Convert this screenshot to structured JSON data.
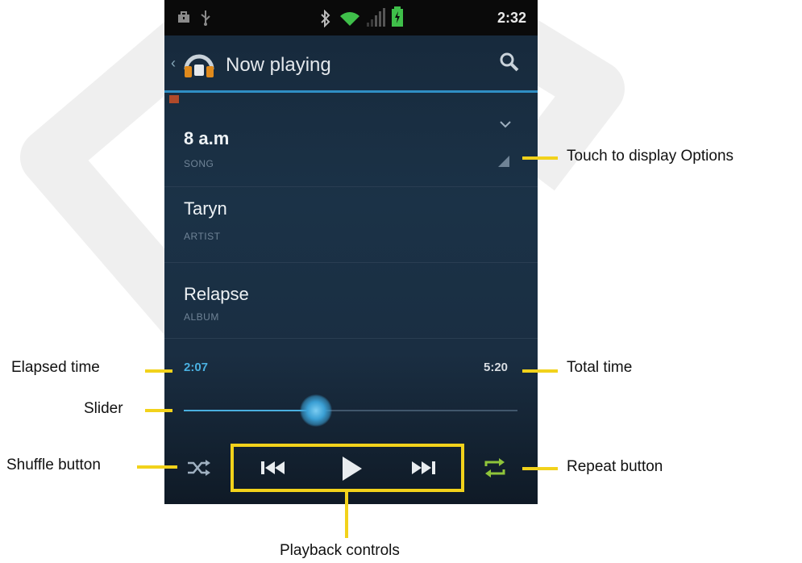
{
  "status_bar": {
    "clock": "2:32"
  },
  "action_bar": {
    "title": "Now playing"
  },
  "track": {
    "song": {
      "value": "8 a.m",
      "label": "SONG"
    },
    "artist": {
      "value": "Taryn",
      "label": "ARTIST"
    },
    "album": {
      "value": "Relapse",
      "label": "ALBUM"
    }
  },
  "playback": {
    "elapsed": "2:07",
    "total": "5:20",
    "progress": 0.397
  },
  "callouts": {
    "options": "Touch to display Options",
    "elapsed": "Elapsed time",
    "total": "Total time",
    "slider": "Slider",
    "shuffle": "Shuffle button",
    "repeat": "Repeat button",
    "playback": "Playback controls"
  },
  "colors": {
    "accent_blue": "#4ab0e0",
    "repeat_green": "#8fc43a",
    "callout_yellow": "#f2d21b"
  },
  "icons": [
    "headphones-icon",
    "search-icon",
    "chevron-down-icon",
    "options-corner-icon",
    "shuffle-icon",
    "previous-icon",
    "play-icon",
    "next-icon",
    "repeat-icon",
    "bluetooth-icon",
    "wifi-icon",
    "signal-icon",
    "battery-icon",
    "usb-icon",
    "briefcase-icon"
  ]
}
